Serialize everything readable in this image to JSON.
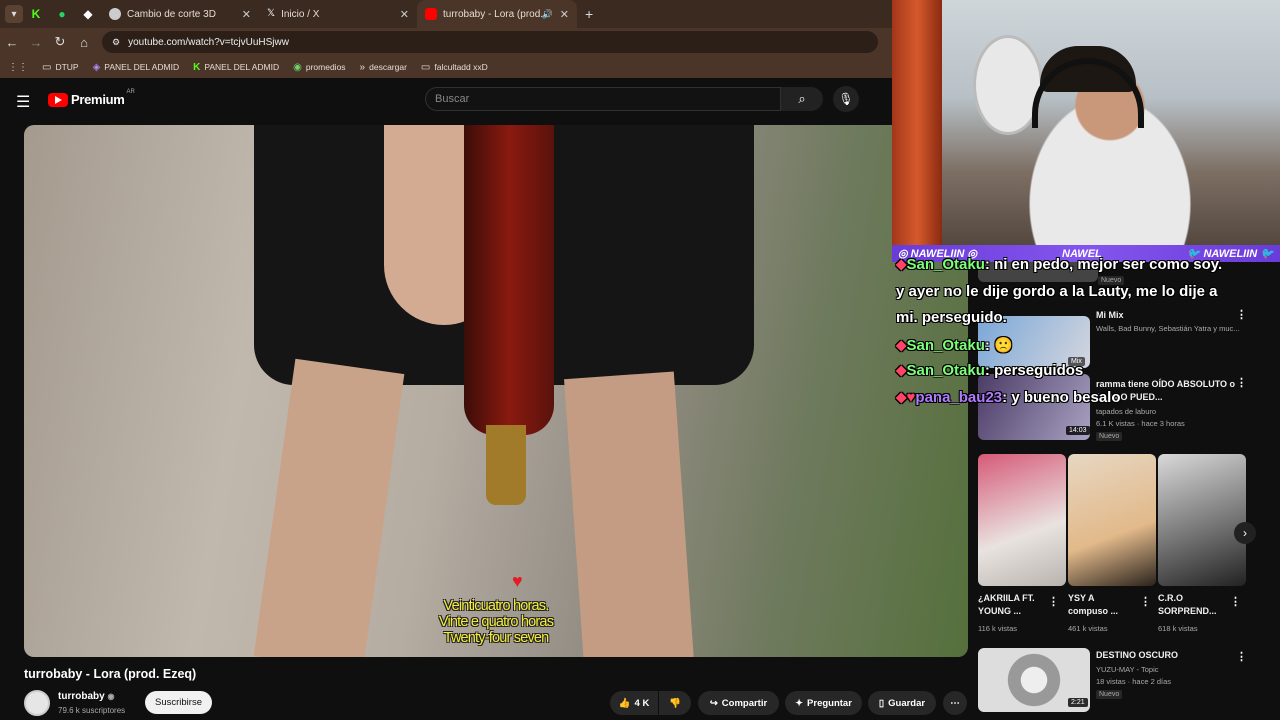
{
  "tabs": [
    {
      "label": "Cambio de corte 3D",
      "icon": "globe-icon"
    },
    {
      "label": "Inicio / X",
      "icon": "x-logo-icon"
    },
    {
      "label": "turrobaby - Lora (prod. Eze",
      "icon": "youtube-icon",
      "active": true
    }
  ],
  "address": {
    "url": "youtube.com/watch?v=tcjvUuHSjww"
  },
  "bookmarks": [
    "DTUP",
    "PANEL DEL ADMID",
    "PANEL DEL ADMID",
    "promedios",
    "descargar",
    "falcultadd xxD"
  ],
  "youtube": {
    "logo": "Premium",
    "region": "AR",
    "search_placeholder": "Buscar",
    "subtitle_lines": [
      "Veinticuatro horas.",
      "Vinte e quatro horas",
      "Twenty-four seven"
    ],
    "video_title": "turrobaby - Lora (prod. Ezeq)",
    "channel": "turrobaby",
    "subscribers": "79.6 k suscriptores",
    "subscribe_label": "Suscribirse",
    "likes": "4 K",
    "share_label": "Compartir",
    "ask_label": "Preguntar",
    "save_label": "Guardar"
  },
  "stream": {
    "banner_left": "NAWELIIN",
    "banner_center": "NAWEL",
    "banner_right": "NAWELIIN",
    "chat": [
      {
        "user": "San_Otaku",
        "text": "ni en pedo, mejor ser como soy."
      },
      {
        "user": "",
        "text": "y ayer no le dije gordo a la Lauty, me lo dije a"
      },
      {
        "user": "",
        "text": "mi. perseguido."
      },
      {
        "user": "San_Otaku",
        "text": "🙁"
      },
      {
        "user": "San_Otaku",
        "text": "perseguidos"
      },
      {
        "user": "pana_bau23",
        "text": "y bueno besalo"
      }
    ]
  },
  "sidebar": {
    "nuevo_badge": "Nuevo",
    "mix": {
      "title": "Mi Mix",
      "meta": "Walls, Bad Bunny, Sebastián Yatra y muc...",
      "badge": "Mix"
    },
    "rec1": {
      "title_line1": "ramma tiene OÍDO ABSOLUTO o",
      "title_line2": "(NO LO PUED...",
      "channel": "tapados de laburo",
      "meta": "6.1 K vistas · hace 3 horas",
      "duration": "14:03",
      "badge": "Nuevo"
    },
    "shorts": [
      {
        "title_line1": "¿AKRIILA FT.",
        "title_line2": "YOUNG ...",
        "views": "116 k vistas"
      },
      {
        "title_line1": "YSY A",
        "title_line2": "compuso ...",
        "views": "461 k vistas"
      },
      {
        "title_line1": "C.R.O",
        "title_line2": "SORPREND...",
        "views": "618 k vistas"
      }
    ],
    "rec2": {
      "title": "DESTINO OSCURO",
      "channel": "YUZU-MAY - Topic",
      "meta": "18 vistas · hace 2 días",
      "duration": "2:21",
      "badge": "Nuevo"
    }
  }
}
